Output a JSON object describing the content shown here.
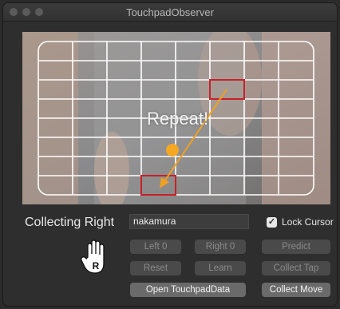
{
  "window": {
    "title": "TouchpadObserver"
  },
  "overlay": {
    "repeat_text": "Repeat!"
  },
  "status": {
    "collecting": "Collecting Right"
  },
  "user": {
    "name_value": "nakamura"
  },
  "lock_cursor": {
    "label": "Lock Cursor",
    "checked": true,
    "check_glyph": "✓"
  },
  "hand_icon": {
    "letter": "R"
  },
  "buttons": {
    "left": "Left 0",
    "right": "Right 0",
    "predict": "Predict",
    "reset": "Reset",
    "learn": "Learn",
    "collect_tap": "Collect Tap",
    "open_data": "Open TouchpadData",
    "collect_move": "Collect Move"
  },
  "colors": {
    "grid_line": "#ffffff",
    "target_box": "#c8202a",
    "arrow": "#f0a020",
    "cursor_dot": "#f5a623"
  }
}
